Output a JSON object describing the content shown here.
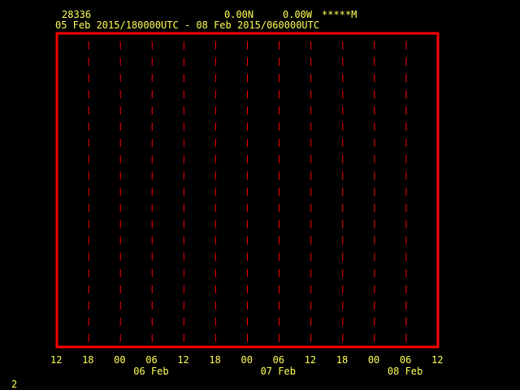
{
  "header": {
    "station_id": "28336",
    "latitude": "0.00N",
    "longitude": "0.00W",
    "elevation": "*****M",
    "time_range": "05 Feb 2015/180000UTC - 08 Feb 2015/060000UTC"
  },
  "footer": {
    "page_number": "2"
  },
  "colors": {
    "frame": "#ff0000",
    "gridline": "#ff0000",
    "text": "#ffff55",
    "background": "#000000"
  },
  "chart_data": {
    "type": "line",
    "title": "",
    "xlabel": "",
    "ylabel": "",
    "series": [],
    "x_ticks": [
      "12",
      "18",
      "00",
      "06",
      "12",
      "18",
      "00",
      "06",
      "12",
      "18",
      "00",
      "06",
      "12"
    ],
    "x_ticks_hours": [
      0,
      6,
      12,
      18,
      24,
      30,
      36,
      42,
      48,
      54,
      60,
      66,
      72
    ],
    "x_range_hours": [
      0,
      72
    ],
    "x_start": "05 Feb 2015 12UTC",
    "x_end": "08 Feb 2015 12UTC",
    "date_labels": [
      {
        "text": "06 Feb",
        "at_hour": 18
      },
      {
        "text": "07 Feb",
        "at_hour": 42
      },
      {
        "text": "08 Feb",
        "at_hour": 66
      }
    ],
    "grid": "dashed vertical lines at each interior tick"
  }
}
